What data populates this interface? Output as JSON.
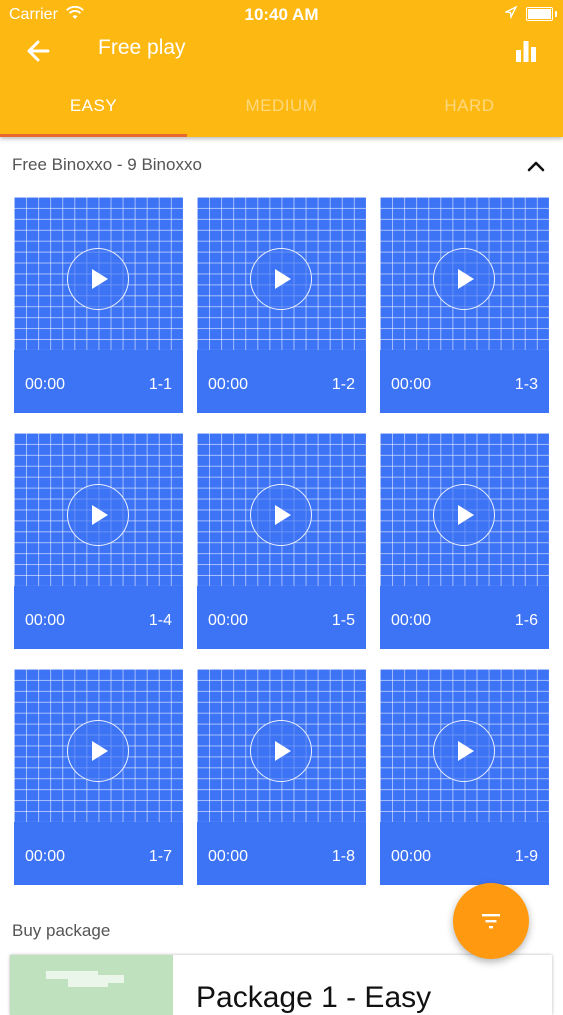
{
  "status_bar": {
    "carrier": "Carrier",
    "time": "10:40 AM"
  },
  "app_bar": {
    "title": "Free play"
  },
  "tabs": [
    {
      "label": "EASY",
      "active": true
    },
    {
      "label": "MEDIUM",
      "active": false
    },
    {
      "label": "HARD",
      "active": false
    }
  ],
  "section": {
    "title": "Free Binoxxo - 9 Binoxxo"
  },
  "puzzles": [
    {
      "time": "00:00",
      "id": "1-1"
    },
    {
      "time": "00:00",
      "id": "1-2"
    },
    {
      "time": "00:00",
      "id": "1-3"
    },
    {
      "time": "00:00",
      "id": "1-4"
    },
    {
      "time": "00:00",
      "id": "1-5"
    },
    {
      "time": "00:00",
      "id": "1-6"
    },
    {
      "time": "00:00",
      "id": "1-7"
    },
    {
      "time": "00:00",
      "id": "1-8"
    },
    {
      "time": "00:00",
      "id": "1-9"
    }
  ],
  "buy_section": {
    "title": "Buy package"
  },
  "package": {
    "title": "Package 1 - Easy"
  },
  "icons": {
    "back": "arrow-left-icon",
    "stats": "bar-chart-icon",
    "collapse": "chevron-up-icon",
    "play": "play-icon",
    "fab": "filter-icon"
  },
  "colors": {
    "app_bar": "#FEB812",
    "tab_indicator": "#E8682E",
    "card": "#3D73F5",
    "fab": "#FF9A10",
    "package_thumb": "#BFE1BE"
  }
}
